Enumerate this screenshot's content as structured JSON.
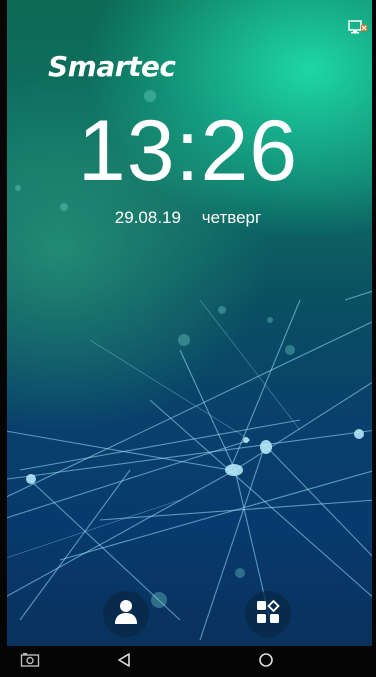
{
  "status_bar": {
    "icon": "network-monitor-icon"
  },
  "brand": {
    "logo_text": "Smartec"
  },
  "lockscreen": {
    "time": "13:26",
    "date": "29.08.19",
    "weekday": "четверг"
  },
  "actions": [
    {
      "icon": "user-icon"
    },
    {
      "icon": "apps-grid-icon"
    }
  ],
  "navbar": [
    {
      "icon": "screenshot-icon"
    },
    {
      "icon": "back-icon"
    },
    {
      "icon": "home-icon"
    }
  ],
  "colors": {
    "accent_teal": "#1edcaa",
    "deep_blue": "#073a6e",
    "text": "#ffffff",
    "navbar": "#050505",
    "status_alert": "#ff6a1a"
  }
}
